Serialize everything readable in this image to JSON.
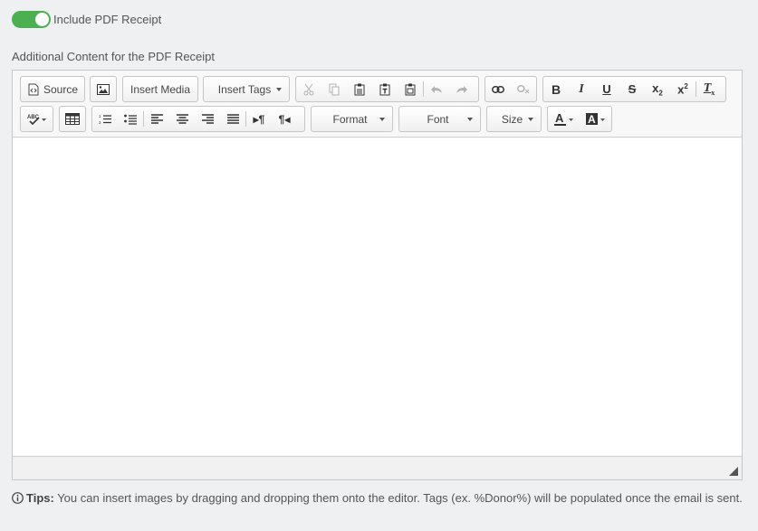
{
  "toggle": {
    "label": "Include PDF Receipt",
    "on": true,
    "color": "#4caf50"
  },
  "section_label": "Additional Content for the PDF Receipt",
  "toolbar": {
    "source_label": "Source",
    "insert_media_label": "Insert Media",
    "insert_tags_label": "Insert Tags",
    "format_label": "Format",
    "font_label": "Font",
    "size_label": "Size",
    "icons": [
      "source-icon",
      "image-icon",
      "cut-icon",
      "copy-icon",
      "paste-icon",
      "paste-text-icon",
      "paste-word-icon",
      "undo-icon",
      "redo-icon",
      "link-icon",
      "unlink-icon",
      "bold-icon",
      "italic-icon",
      "underline-icon",
      "strikethrough-icon",
      "subscript-icon",
      "superscript-icon",
      "remove-format-icon",
      "spellcheck-icon",
      "table-icon",
      "numbered-list-icon",
      "bulleted-list-icon",
      "align-left-icon",
      "align-center-icon",
      "align-right-icon",
      "justify-icon",
      "ltr-icon",
      "rtl-icon",
      "text-color-icon",
      "background-color-icon"
    ]
  },
  "tips": {
    "title": "Tips:",
    "text": " You can insert images by dragging and dropping them onto the editor. Tags (ex. %Donor%) will be populated once the email is sent."
  }
}
